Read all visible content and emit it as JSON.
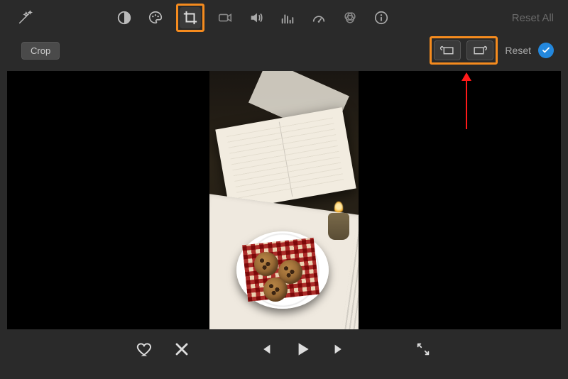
{
  "toolbar": {
    "magic_wand": "",
    "reset_all_label": "Reset All"
  },
  "crop_row": {
    "crop_label": "Crop",
    "reset_label": "Reset"
  },
  "icons": {
    "wand": "wand",
    "contrast": "contrast",
    "palette": "palette",
    "crop": "crop",
    "camera": "camera",
    "volume": "volume",
    "equalizer": "equalizer",
    "speedometer": "speedometer",
    "color_filters": "color-filters",
    "info": "info",
    "rotate_ccw": "rotate-ccw",
    "rotate_cw": "rotate-cw",
    "check": "check",
    "heart": "heart",
    "reject": "reject",
    "prev": "previous",
    "play": "play",
    "next": "next",
    "fullscreen": "fullscreen"
  }
}
